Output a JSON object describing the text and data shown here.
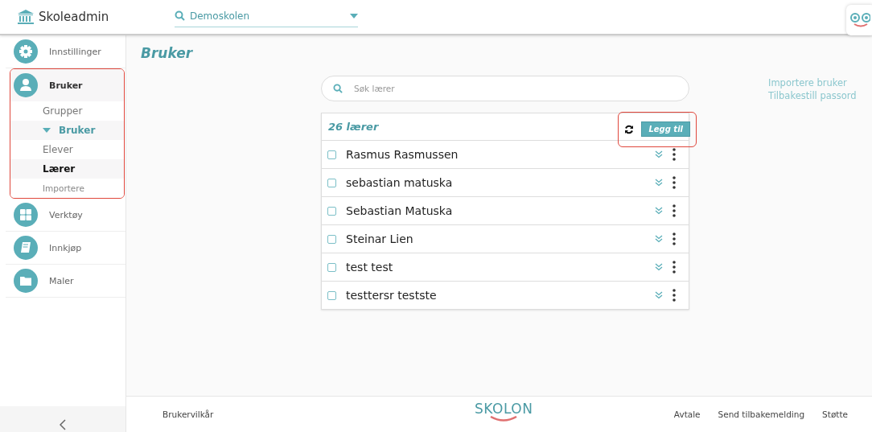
{
  "app": {
    "title": "Skoleadmin"
  },
  "school_picker": {
    "value": "Demoskolen"
  },
  "sidebar": {
    "items": [
      {
        "label": "Innstillinger",
        "highlighted": false,
        "selected": false
      },
      {
        "label": "Bruker",
        "highlighted": true,
        "selected": true,
        "children": [
          {
            "label": "Grupper",
            "kind": "link",
            "selected": false
          },
          {
            "label": "Bruker",
            "kind": "section",
            "selected": false
          },
          {
            "label": "Elever",
            "kind": "link",
            "selected": false
          },
          {
            "label": "Lærer",
            "kind": "link",
            "selected": true
          },
          {
            "label": "Importere",
            "kind": "small",
            "selected": false
          }
        ]
      },
      {
        "label": "Verktøy",
        "highlighted": false,
        "selected": false
      },
      {
        "label": "Innkjøp",
        "highlighted": false,
        "selected": false
      },
      {
        "label": "Maler",
        "highlighted": false,
        "selected": false
      }
    ]
  },
  "page_title": "Bruker",
  "search": {
    "placeholder": "Søk lærer"
  },
  "side_links": [
    "Importere bruker",
    "Tilbakestill passord"
  ],
  "list": {
    "title": "26 lærer",
    "actions_highlighted": true,
    "add_button": "Legg til",
    "rows": [
      {
        "name": "Rasmus Rasmussen",
        "checked": false
      },
      {
        "name": "sebastian matuska",
        "checked": false
      },
      {
        "name": "Sebastian Matuska",
        "checked": false
      },
      {
        "name": "Steinar Lien",
        "checked": false
      },
      {
        "name": "test test",
        "checked": false
      },
      {
        "name": "testtersr testste",
        "checked": false
      }
    ]
  },
  "footer": {
    "left": "Brukervilkår",
    "logo": "SKOLON",
    "links": [
      "Avtale",
      "Send tilbakemelding",
      "Støtte"
    ]
  }
}
